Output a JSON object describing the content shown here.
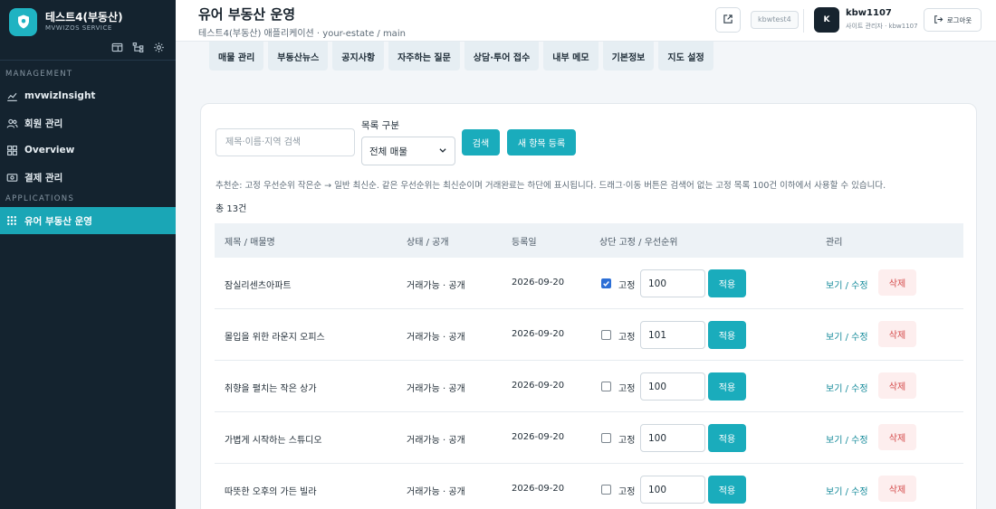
{
  "sidebar": {
    "brand_title": "테스트4(부동산)",
    "brand_subtitle": "MVWIZOS SERVICE",
    "tools": [
      "layout-icon",
      "sitemap-icon",
      "gear-icon"
    ],
    "sections": [
      {
        "title": "MANAGEMENT",
        "items": [
          {
            "label": "mvwizInsight",
            "icon": "chart-line-icon",
            "active": false
          },
          {
            "label": "회원 관리",
            "icon": "users-icon",
            "active": false
          },
          {
            "label": "Overview",
            "icon": "grid-icon",
            "active": false
          },
          {
            "label": "결제 관리",
            "icon": "payment-icon",
            "active": false
          }
        ]
      },
      {
        "title": "APPLICATIONS",
        "items": [
          {
            "label": "유어 부동산 운영",
            "icon": "apps-icon",
            "active": true
          }
        ]
      }
    ]
  },
  "header": {
    "title": "유어 부동산 운영",
    "breadcrumb": "테스트4(부동산) 애플리케이션 · your-estate / main",
    "site_tag": "kbwtest4",
    "avatar_initial": "K",
    "user_name": "kbw1107",
    "user_role": "사이트 관리자 · kbw1107",
    "logout_label": "로그아웃"
  },
  "tabs": [
    "매물 관리",
    "부동산뉴스",
    "공지사항",
    "자주하는 질문",
    "상담·투어 접수",
    "내부 메모",
    "기본정보",
    "지도 설정"
  ],
  "filters": {
    "search_placeholder": "제목·이름·지역 검색",
    "category_label": "목록 구분",
    "category_value": "전체 매물",
    "search_button": "검색",
    "add_button": "새 항목 등록"
  },
  "hint": "추천순: 고정 우선순위 작은순 → 일반 최신순. 같은 우선순위는 최신순이며 거래완료는 하단에 표시됩니다. 드래그·이동 버튼은 검색어 없는 고정 목록 100건 이하에서 사용할 수 있습니다.",
  "total": "총 13건",
  "table": {
    "headers": [
      "제목 / 매물명",
      "상태 / 공개",
      "등록일",
      "상단 고정 / 우선순위",
      "관리"
    ],
    "rows": [
      {
        "title": "잠실리센츠아파트",
        "status": "거래가능 · 공개",
        "date": "2026-09-20",
        "pinned": true,
        "pin_label": "고정",
        "priority": "100",
        "apply": "적용",
        "edit": "보기 / 수정",
        "delete": "삭제"
      },
      {
        "title": "몰입을 위한 라운지 오피스",
        "status": "거래가능 · 공개",
        "date": "2026-09-20",
        "pinned": false,
        "pin_label": "고정",
        "priority": "101",
        "apply": "적용",
        "edit": "보기 / 수정",
        "delete": "삭제"
      },
      {
        "title": "취향을 펼치는 작은 상가",
        "status": "거래가능 · 공개",
        "date": "2026-09-20",
        "pinned": false,
        "pin_label": "고정",
        "priority": "100",
        "apply": "적용",
        "edit": "보기 / 수정",
        "delete": "삭제"
      },
      {
        "title": "가볍게 시작하는 스튜디오",
        "status": "거래가능 · 공개",
        "date": "2026-09-20",
        "pinned": false,
        "pin_label": "고정",
        "priority": "100",
        "apply": "적용",
        "edit": "보기 / 수정",
        "delete": "삭제"
      },
      {
        "title": "따뜻한 오후의 가든 빌라",
        "status": "거래가능 · 공개",
        "date": "2026-09-20",
        "pinned": false,
        "pin_label": "고정",
        "priority": "100",
        "apply": "적용",
        "edit": "보기 / 수정",
        "delete": "삭제"
      }
    ]
  },
  "colors": {
    "accent": "#1aacbc",
    "sidebar_bg": "#14232f",
    "danger": "#d44a4a"
  }
}
